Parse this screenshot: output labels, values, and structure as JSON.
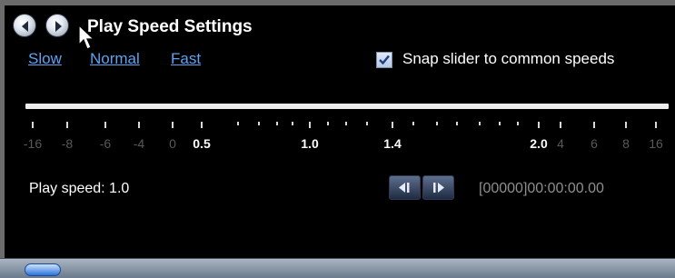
{
  "window": {
    "title": "Play Speed Settings"
  },
  "presets": [
    {
      "label": "Slow"
    },
    {
      "label": "Normal"
    },
    {
      "label": "Fast"
    }
  ],
  "snap": {
    "label": "Snap slider to common speeds",
    "checked": true
  },
  "slider": {
    "scale_labels": [
      "-16",
      "-8",
      "-6",
      "-4",
      "0",
      "0.5",
      "1.0",
      "1.4",
      "2.0",
      "4",
      "6",
      "8",
      "16"
    ],
    "value": "1.0"
  },
  "status": {
    "play_speed": "Play speed: 1.0",
    "timecode": "[00000]00:00:00.00"
  },
  "icons": {
    "back": "back-arrow-icon",
    "forward": "forward-arrow-icon",
    "cursor": "mouse-cursor-icon",
    "step_back": "step-back-icon",
    "step_forward": "step-forward-icon"
  }
}
